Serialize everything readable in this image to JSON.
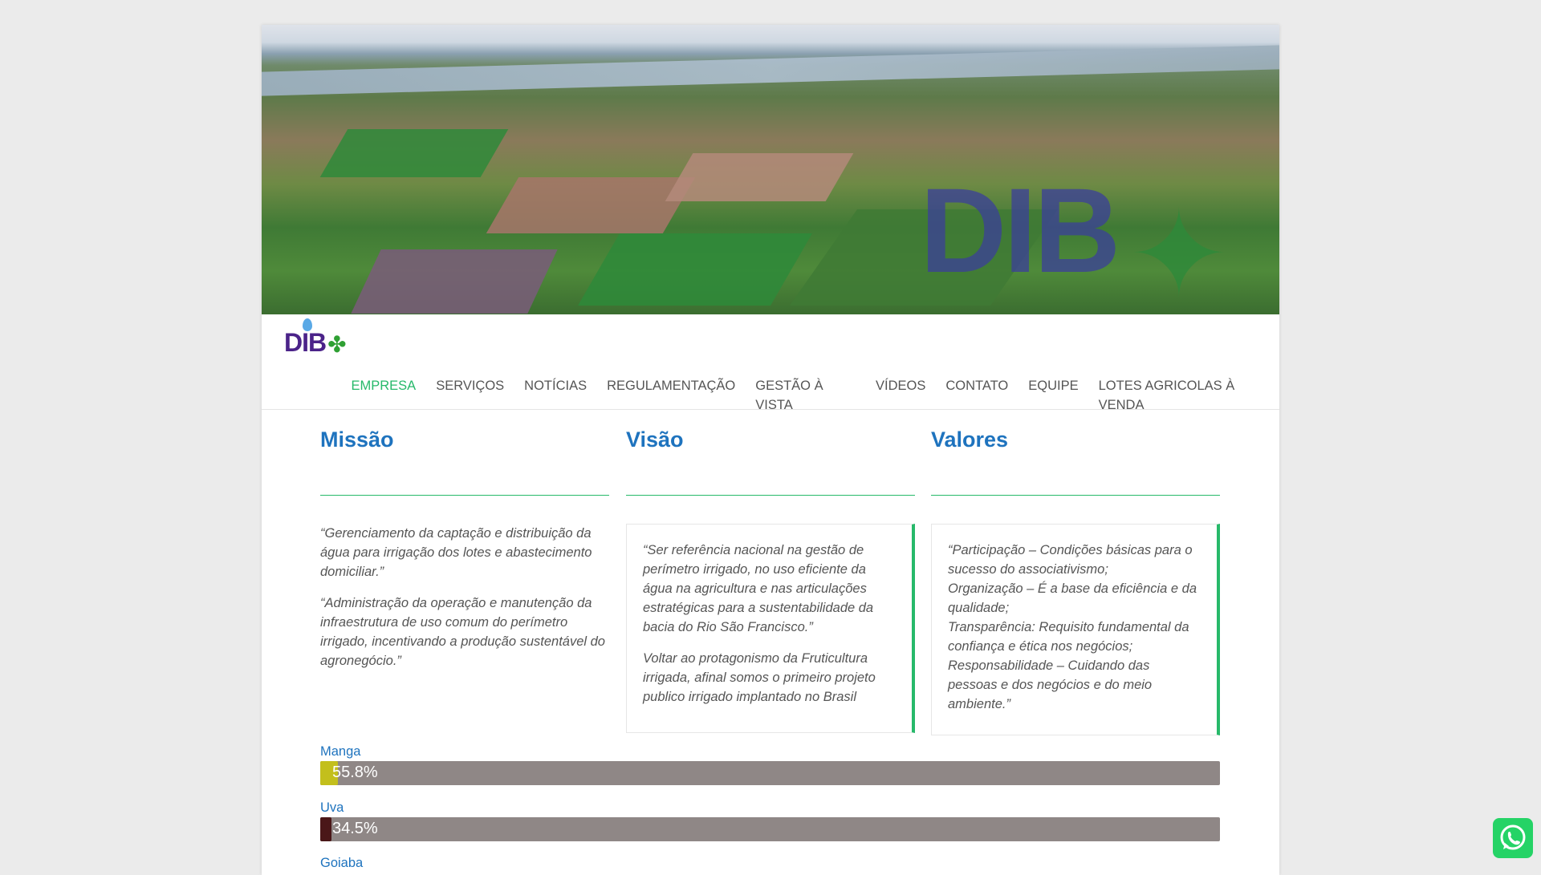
{
  "logo": {
    "text": "DIB"
  },
  "nav": {
    "items": [
      "EMPRESA",
      "SERVIÇOS",
      "NOTÍCIAS",
      "REGULAMENTAÇÃO",
      "GESTÃO À VISTA",
      "VÍDEOS",
      "CONTATO",
      "EQUIPE",
      "LOTES AGRICOLAS À VENDA"
    ],
    "active": "EMPRESA"
  },
  "missao": {
    "title": "Missão",
    "paragraphs": [
      "“Gerenciamento da captação e distribuição da água para irrigação dos lotes e abastecimento domiciliar.”",
      "“Administração da operação e manutenção da infraestrutura de uso comum do perímetro irrigado, incentivando a produção sustentável do agronegócio.”"
    ]
  },
  "visao": {
    "title": "Visão",
    "paragraphs": [
      "“Ser referência nacional na gestão de perímetro irrigado, no uso eficiente da água na agricultura e nas articulações estratégicas para a sustentabilidade da bacia do Rio São Francisco.”",
      "Voltar ao protagonismo da Fruticultura irrigada, afinal somos o primeiro projeto publico irrigado implantado no Brasil"
    ]
  },
  "valores": {
    "title": "Valores",
    "lines": [
      "“Participação – Condições básicas para o sucesso do associativismo;",
      "Organização – É a base da eficiência e da qualidade;",
      "Transparência: Requisito fundamental da confiança e ética nos negócios;",
      "Responsabilidade – Cuidando das pessoas e dos negócios e do meio ambiente.”"
    ]
  },
  "skills": [
    {
      "label": "Manga",
      "percent": "55.8%",
      "value": 55.8,
      "color": "#c3bf1c"
    },
    {
      "label": "Uva",
      "percent": "34.5%",
      "value": 34.5,
      "color": "#4a1718"
    },
    {
      "label": "Goiaba"
    }
  ],
  "colors": {
    "heading": "#1e73be",
    "accent": "#27b96a",
    "bar_track": "#8f8786"
  }
}
